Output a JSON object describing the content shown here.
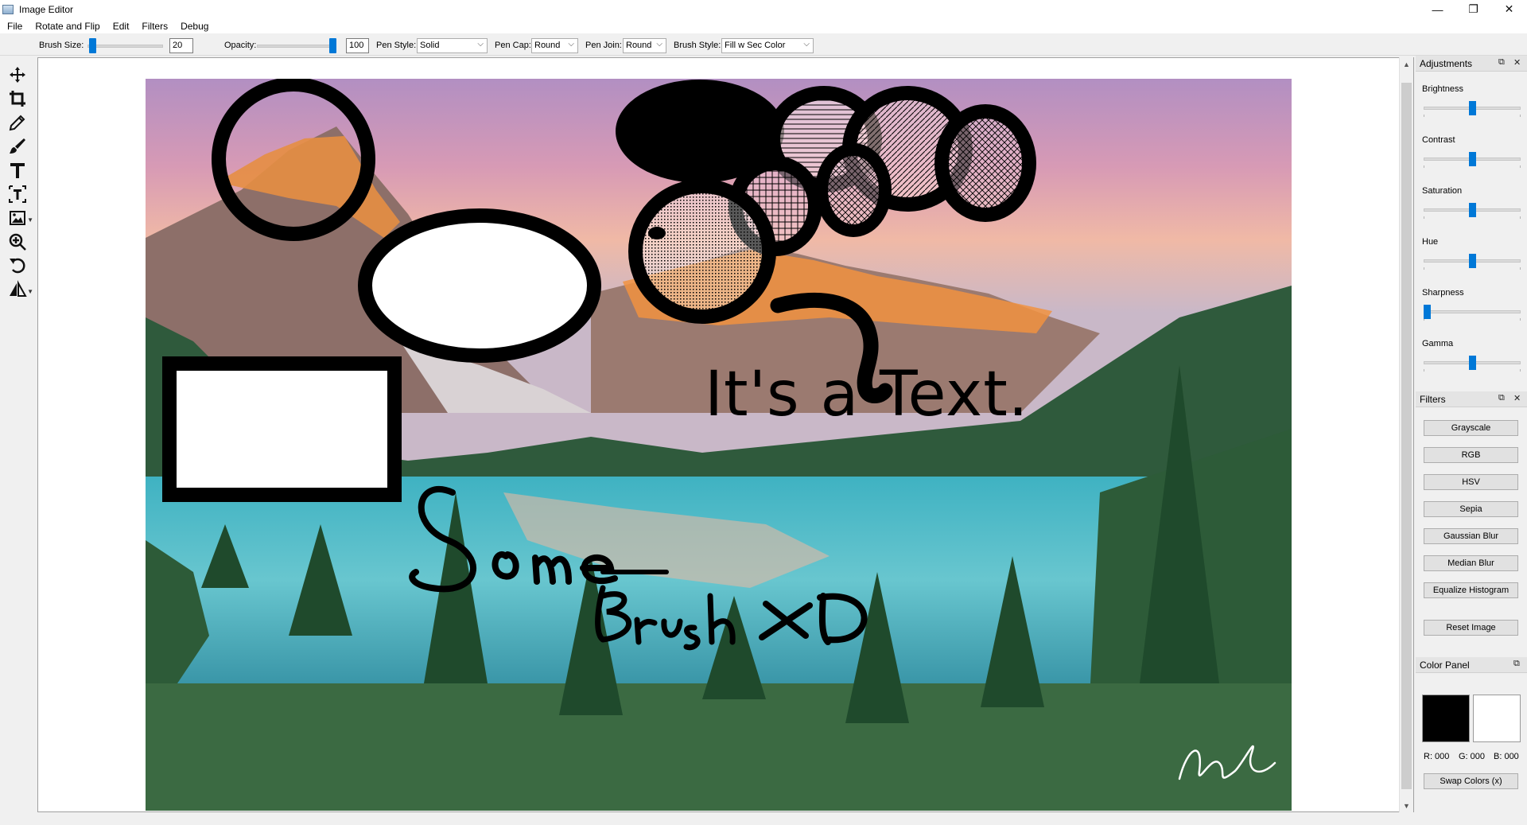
{
  "window": {
    "title": "Image Editor",
    "minimize": "—",
    "maximize": "❐",
    "close": "✕"
  },
  "menu": [
    "File",
    "Rotate and Flip",
    "Edit",
    "Filters",
    "Debug"
  ],
  "options": {
    "brush_size_label": "Brush Size:",
    "brush_size_value": "20",
    "brush_size_fraction": 0.02,
    "opacity_label": "Opacity:",
    "opacity_value": "100",
    "opacity_fraction": 1.0,
    "pen_style_label": "Pen Style:",
    "pen_style_value": "Solid",
    "pen_cap_label": "Pen Cap:",
    "pen_cap_value": "Round",
    "pen_join_label": "Pen Join:",
    "pen_join_value": "Round",
    "brush_style_label": "Brush Style:",
    "brush_style_value": "Fill w Sec Color"
  },
  "tools": [
    "move-icon",
    "crop-icon",
    "pencil-icon",
    "brush-icon",
    "text-icon",
    "text-box-icon",
    "image-icon",
    "zoom-icon",
    "rotate-icon",
    "flip-icon"
  ],
  "canvas": {
    "text_label": "It's a Text.",
    "brush_word_1": "Some",
    "brush_word_2": "Brush",
    "brush_word_3": "xD"
  },
  "adjustments": {
    "title": "Adjustments",
    "sliders": [
      {
        "label": "Brightness",
        "fraction": 0.5
      },
      {
        "label": "Contrast",
        "fraction": 0.5
      },
      {
        "label": "Saturation",
        "fraction": 0.5
      },
      {
        "label": "Hue",
        "fraction": 0.5
      },
      {
        "label": "Sharpness",
        "fraction": 0.0
      },
      {
        "label": "Gamma",
        "fraction": 0.5
      }
    ]
  },
  "filters": {
    "title": "Filters",
    "buttons": [
      "Grayscale",
      "RGB",
      "HSV",
      "Sepia",
      "Gaussian Blur",
      "Median Blur",
      "Equalize Histogram"
    ],
    "reset": "Reset Image"
  },
  "color_panel": {
    "title": "Color Panel",
    "primary_color": "#000000",
    "secondary_color": "#ffffff",
    "r_label": "R: 000",
    "g_label": "G: 000",
    "b_label": "B: 000",
    "swap_label": "Swap Colors (x)"
  },
  "colors": {
    "accent": "#0078d7"
  }
}
